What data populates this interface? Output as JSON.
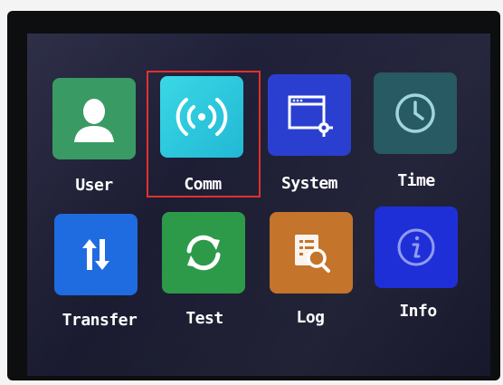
{
  "menu": {
    "items": [
      {
        "key": "user",
        "label": "User",
        "icon": "user-icon",
        "color": "#3a9a63"
      },
      {
        "key": "comm",
        "label": "Comm",
        "icon": "signal-icon",
        "color": "#27c6dc"
      },
      {
        "key": "system",
        "label": "System",
        "icon": "settings-window-icon",
        "color": "#2a3fd0"
      },
      {
        "key": "time",
        "label": "Time",
        "icon": "clock-icon",
        "color": "#275a62"
      },
      {
        "key": "transfer",
        "label": "Transfer",
        "icon": "transfer-arrows-icon",
        "color": "#1f6be0"
      },
      {
        "key": "test",
        "label": "Test",
        "icon": "refresh-icon",
        "color": "#2d9a49"
      },
      {
        "key": "log",
        "label": "Log",
        "icon": "log-search-icon",
        "color": "#c4742b"
      },
      {
        "key": "info",
        "label": "Info",
        "icon": "info-icon",
        "color": "#1f2fd8"
      }
    ],
    "selected": "comm",
    "selection_color": "#e0322c"
  }
}
